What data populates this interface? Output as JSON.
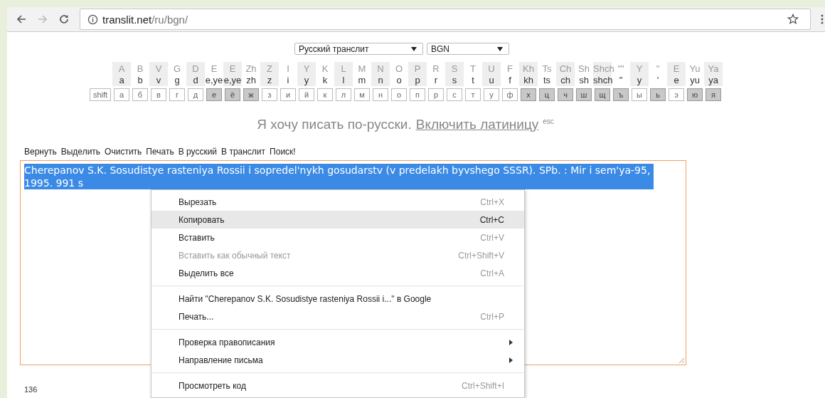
{
  "browser": {
    "url_host": "translit.net",
    "url_path": "/ru/bgn/"
  },
  "selects": [
    {
      "value": "Русский транслит"
    },
    {
      "value": "BGN"
    }
  ],
  "keyboard": {
    "shift_label": "shift",
    "keys": [
      {
        "upper": "A",
        "lower": "a",
        "key": "а",
        "highlighted": false
      },
      {
        "upper": "B",
        "lower": "b",
        "key": "б",
        "highlighted": false
      },
      {
        "upper": "V",
        "lower": "v",
        "key": "в",
        "highlighted": false
      },
      {
        "upper": "G",
        "lower": "g",
        "key": "г",
        "highlighted": false
      },
      {
        "upper": "D",
        "lower": "d",
        "key": "д",
        "highlighted": false
      },
      {
        "upper": "E",
        "lower": "e,ye",
        "key": "е",
        "highlighted": true
      },
      {
        "upper": "E",
        "lower": "e,ye",
        "key": "ё",
        "highlighted": true
      },
      {
        "upper": "Zh",
        "lower": "zh",
        "key": "ж",
        "highlighted": true
      },
      {
        "upper": "Z",
        "lower": "z",
        "key": "з",
        "highlighted": false
      },
      {
        "upper": "I",
        "lower": "i",
        "key": "и",
        "highlighted": false
      },
      {
        "upper": "Y",
        "lower": "y",
        "key": "й",
        "highlighted": false
      },
      {
        "upper": "K",
        "lower": "k",
        "key": "к",
        "highlighted": false
      },
      {
        "upper": "L",
        "lower": "l",
        "key": "л",
        "highlighted": false
      },
      {
        "upper": "M",
        "lower": "m",
        "key": "м",
        "highlighted": false
      },
      {
        "upper": "N",
        "lower": "n",
        "key": "н",
        "highlighted": false
      },
      {
        "upper": "O",
        "lower": "o",
        "key": "о",
        "highlighted": false
      },
      {
        "upper": "P",
        "lower": "p",
        "key": "п",
        "highlighted": false
      },
      {
        "upper": "R",
        "lower": "r",
        "key": "р",
        "highlighted": false
      },
      {
        "upper": "S",
        "lower": "s",
        "key": "с",
        "highlighted": false
      },
      {
        "upper": "T",
        "lower": "t",
        "key": "т",
        "highlighted": false
      },
      {
        "upper": "U",
        "lower": "u",
        "key": "у",
        "highlighted": false
      },
      {
        "upper": "F",
        "lower": "f",
        "key": "ф",
        "highlighted": false
      },
      {
        "upper": "Kh",
        "lower": "kh",
        "key": "х",
        "highlighted": true
      },
      {
        "upper": "Ts",
        "lower": "ts",
        "key": "ц",
        "highlighted": true
      },
      {
        "upper": "Ch",
        "lower": "ch",
        "key": "ч",
        "highlighted": true
      },
      {
        "upper": "Sh",
        "lower": "sh",
        "key": "ш",
        "highlighted": true
      },
      {
        "upper": "Shch",
        "lower": "shch",
        "key": "щ",
        "highlighted": true
      },
      {
        "upper": "\"\"",
        "lower": "\"",
        "key": "ъ",
        "highlighted": true
      },
      {
        "upper": "Y",
        "lower": "y",
        "key": "ы",
        "highlighted": false
      },
      {
        "upper": "\"",
        "lower": "'",
        "key": "ь",
        "highlighted": true
      },
      {
        "upper": "E",
        "lower": "e",
        "key": "э",
        "highlighted": false
      },
      {
        "upper": "Yu",
        "lower": "yu",
        "key": "ю",
        "highlighted": true
      },
      {
        "upper": "Ya",
        "lower": "ya",
        "key": "я",
        "highlighted": true
      }
    ]
  },
  "prompt": {
    "text": "Я хочу писать по-русски.",
    "link": "Включить латиницу",
    "hint": "esc"
  },
  "actions": [
    "Вернуть",
    "Выделить",
    "Очистить",
    "Печать",
    "В русский",
    "В транслит",
    "Поиск!"
  ],
  "editor": {
    "text": "Cherepanov S.K. Sosudistye rasteniya Rossii i sopredel'nykh gosudarstv (v predelakh byvshego SSSR). SPb. : Mir i sem'ya-95, 1995. 991 s",
    "selected": true
  },
  "context_menu": {
    "items": [
      {
        "kind": "item",
        "label": "Вырезать",
        "shortcut": "Ctrl+X",
        "disabled": false,
        "highlighted": false,
        "submenu": false
      },
      {
        "kind": "item",
        "label": "Копировать",
        "shortcut": "Ctrl+C",
        "disabled": false,
        "highlighted": true,
        "submenu": false
      },
      {
        "kind": "item",
        "label": "Вставить",
        "shortcut": "Ctrl+V",
        "disabled": false,
        "highlighted": false,
        "submenu": false
      },
      {
        "kind": "item",
        "label": "Вставить как обычный текст",
        "shortcut": "Ctrl+Shift+V",
        "disabled": true,
        "highlighted": false,
        "submenu": false
      },
      {
        "kind": "item",
        "label": "Выделить все",
        "shortcut": "Ctrl+A",
        "disabled": false,
        "highlighted": false,
        "submenu": false
      },
      {
        "kind": "separator"
      },
      {
        "kind": "item",
        "label": "Найти \"Cherepanov S.K. Sosudistye rasteniya Rossii i...\" в Google",
        "disabled": false,
        "highlighted": false,
        "submenu": false
      },
      {
        "kind": "item",
        "label": "Печать...",
        "shortcut": "Ctrl+P",
        "disabled": false,
        "highlighted": false,
        "submenu": false
      },
      {
        "kind": "separator"
      },
      {
        "kind": "item",
        "label": "Проверка правописания",
        "disabled": false,
        "highlighted": false,
        "submenu": true
      },
      {
        "kind": "item",
        "label": "Направление письма",
        "disabled": false,
        "highlighted": false,
        "submenu": true
      },
      {
        "kind": "separator"
      },
      {
        "kind": "item",
        "label": "Просмотреть код",
        "shortcut": "Ctrl+Shift+I",
        "disabled": false,
        "highlighted": false,
        "submenu": false
      }
    ]
  },
  "counter": "136"
}
